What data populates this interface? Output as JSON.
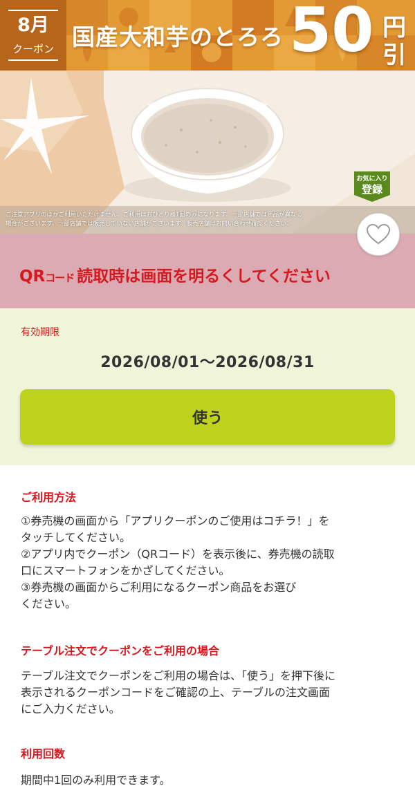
{
  "coupon": {
    "month": "8月",
    "coupon_label": "クーポン",
    "product_name": "国産大和芋のとろろ",
    "discount_amount": "50",
    "discount_unit_top": "円",
    "discount_unit_bottom": "引",
    "disclaimer_lines": [
      "ご注意アプリのほかご利用いただけません。ご利用はおひとり様1回のみになります。一部店舗では商品が異なる",
      "場合がございます。一部店舗では販売していない店舗がございます。販売店舗はお問い合わせ確認ください。"
    ],
    "favorite_tag_top": "お気に入り",
    "favorite_tag_bottom": "登録"
  },
  "qr_notice": {
    "qr": "QR",
    "code": "コード",
    "message": "読取時は画面を明るくしてください"
  },
  "validity": {
    "label": "有効期限",
    "dates": "2026/08/01〜2026/08/31",
    "use_button_label": "使う"
  },
  "sections": {
    "how_to_use": {
      "heading": "ご利用方法",
      "lines": [
        "①券売機の画面から「アプリクーポンのご使用はコチラ！」を",
        "タッチしてください。",
        "②アプリ内でクーポン（QRコード）を表示後に、券売機の読取",
        "口にスマートフォンをかざしてください。",
        "③券売機の画面からご利用になるクーポン商品をお選び",
        "ください。"
      ]
    },
    "table_order": {
      "heading": "テーブル注文でクーポンをご利用の場合",
      "lines": [
        "テーブル注文でクーポンをご利用の場合は、「使う」を押下後に",
        "表示されるクーポンコードをご確認の上、テーブルの注文画面",
        "にご入力ください。"
      ]
    },
    "usage_count": {
      "heading": "利用回数",
      "lines": [
        "期間中1回のみ利用できます。"
      ]
    }
  },
  "colors": {
    "accent_red": "#d6191f",
    "use_button": "#bfd31e",
    "qr_band": "#dcaab2",
    "validity_band": "#f0f5d9",
    "banner_orange": "#df8a25"
  },
  "icons": {
    "favorite": "heart-icon"
  }
}
